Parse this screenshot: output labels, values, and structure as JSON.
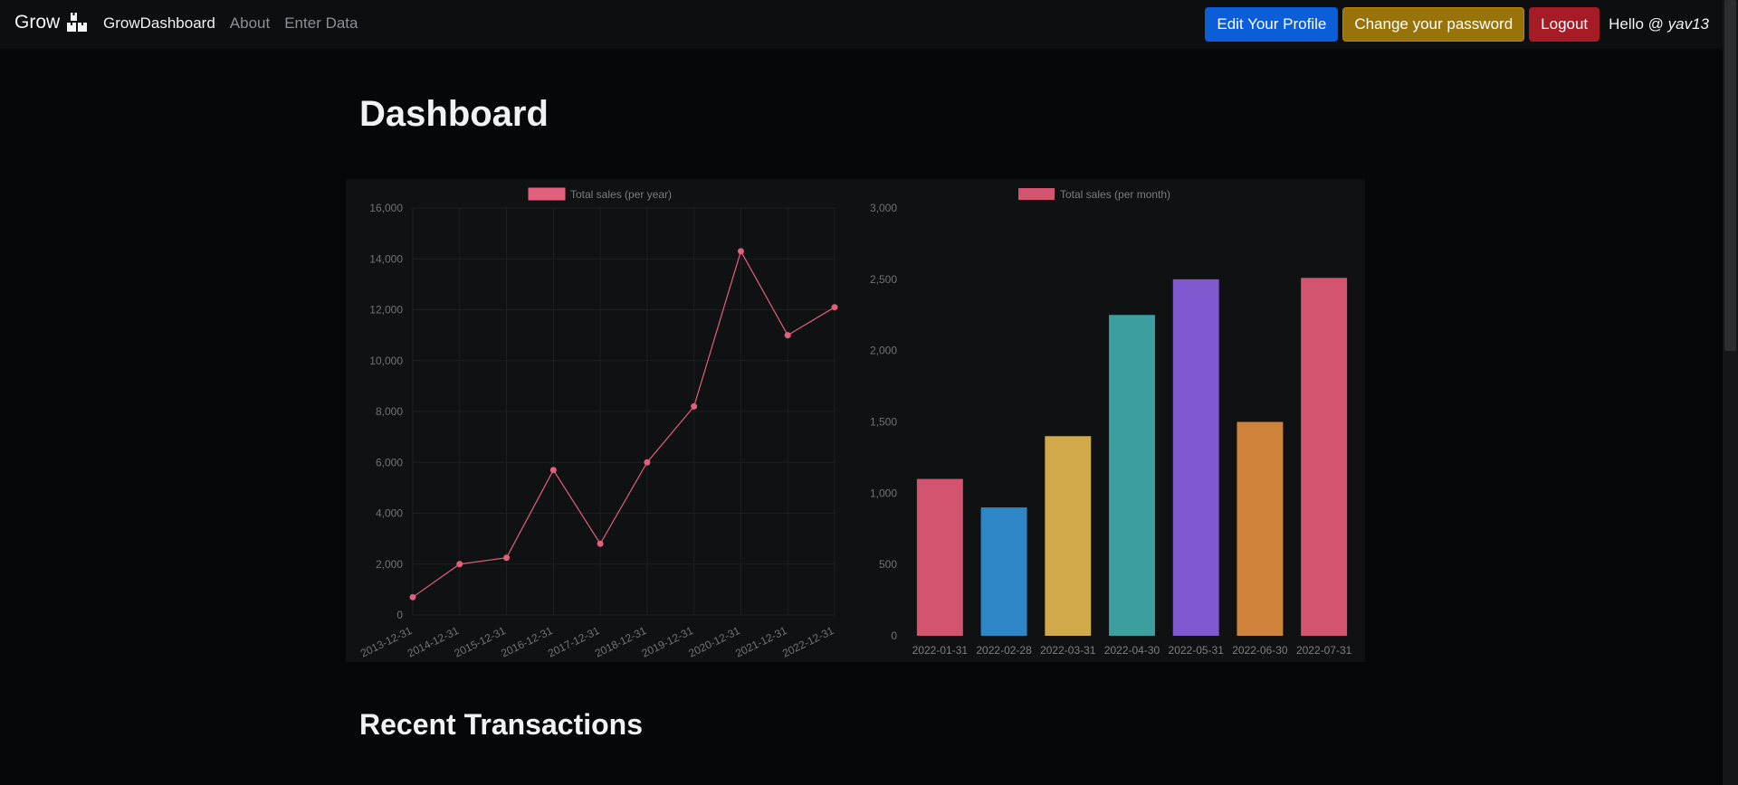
{
  "navbar": {
    "brand": "Grow",
    "brand_icon": "boxes-icon",
    "links": [
      {
        "label": "GrowDashboard",
        "active": true
      },
      {
        "label": "About",
        "active": false
      },
      {
        "label": "Enter Data",
        "active": false
      }
    ],
    "edit_profile_label": "Edit Your Profile",
    "change_password_label": "Change your password",
    "logout_label": "Logout",
    "hello_prefix": "Hello @",
    "username": "yav13"
  },
  "page": {
    "title": "Dashboard",
    "section_title": "Recent Transactions"
  },
  "colors": {
    "primary": "#0b5ed7",
    "warning": "#977309",
    "danger": "#a51c26",
    "line": "#e0607e"
  },
  "chart_data": [
    {
      "type": "line",
      "legend": [
        "Total sales (per year)"
      ],
      "x": [
        "2013-12-31",
        "2014-12-31",
        "2015-12-31",
        "2016-12-31",
        "2017-12-31",
        "2018-12-31",
        "2019-12-31",
        "2020-12-31",
        "2021-12-31",
        "2022-12-31"
      ],
      "series": [
        {
          "name": "Total sales (per year)",
          "color": "#e0607e",
          "values": [
            700,
            2000,
            2250,
            5700,
            2800,
            6000,
            8200,
            14300,
            11000,
            12100
          ]
        }
      ],
      "ylim": [
        0,
        16000
      ],
      "yticks": [
        "0",
        "2,000",
        "4,000",
        "6,000",
        "8,000",
        "10,000",
        "12,000",
        "14,000",
        "16,000"
      ],
      "grid": true,
      "legend_position": "top"
    },
    {
      "type": "bar",
      "legend": [
        "Total sales (per month)"
      ],
      "categories": [
        "2022-01-31",
        "2022-02-28",
        "2022-03-31",
        "2022-04-30",
        "2022-05-31",
        "2022-06-30",
        "2022-07-31"
      ],
      "series": [
        {
          "name": "Total sales (per month)",
          "values": [
            1100,
            900,
            1400,
            2250,
            2500,
            1500,
            2510
          ]
        }
      ],
      "bar_colors": [
        "#d2546f",
        "#2f86c6",
        "#d0a94b",
        "#3c9f9f",
        "#8058d0",
        "#cf823a",
        "#d2546f"
      ],
      "legend_color": "#d2546f",
      "ylim": [
        0,
        3000
      ],
      "yticks": [
        "0",
        "500",
        "1,000",
        "1,500",
        "2,000",
        "2,500",
        "3,000"
      ],
      "grid": false,
      "legend_position": "top"
    }
  ]
}
